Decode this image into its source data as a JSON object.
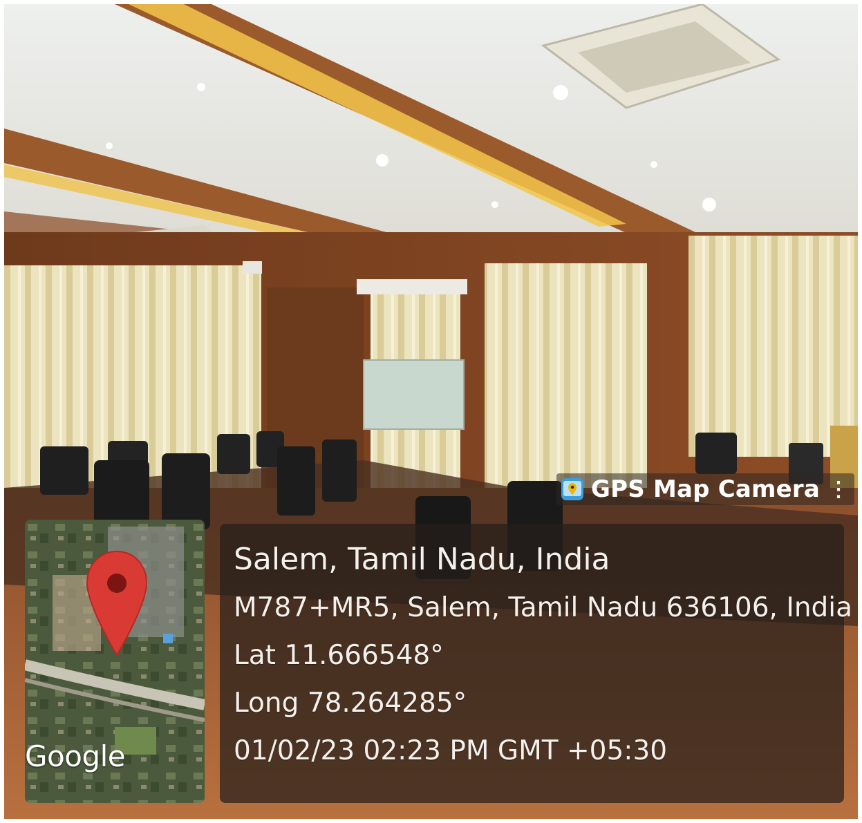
{
  "overlay": {
    "app_name": "GPS Map Camera",
    "app_icon": "gps-map-camera-app-icon",
    "menu_icon": "vertical-dots-icon",
    "map": {
      "attribution": "Google",
      "marker_icon": "map-pin-icon",
      "marker_color": "#d93a34"
    },
    "location": {
      "title": "Salem, Tamil Nadu, India",
      "address": "M787+MR5, Salem, Tamil Nadu 636106, India",
      "latitude": "Lat 11.666548°",
      "longitude": "Long 78.264285°",
      "datetime": "01/02/23 02:23 PM GMT +05:30"
    }
  },
  "colors": {
    "panel_bg": "#261f1a",
    "wood": "#8a4a24",
    "curtain": "#e6ddb0",
    "ceiling": "#f2f0ea",
    "floor": "#9b5a34"
  }
}
